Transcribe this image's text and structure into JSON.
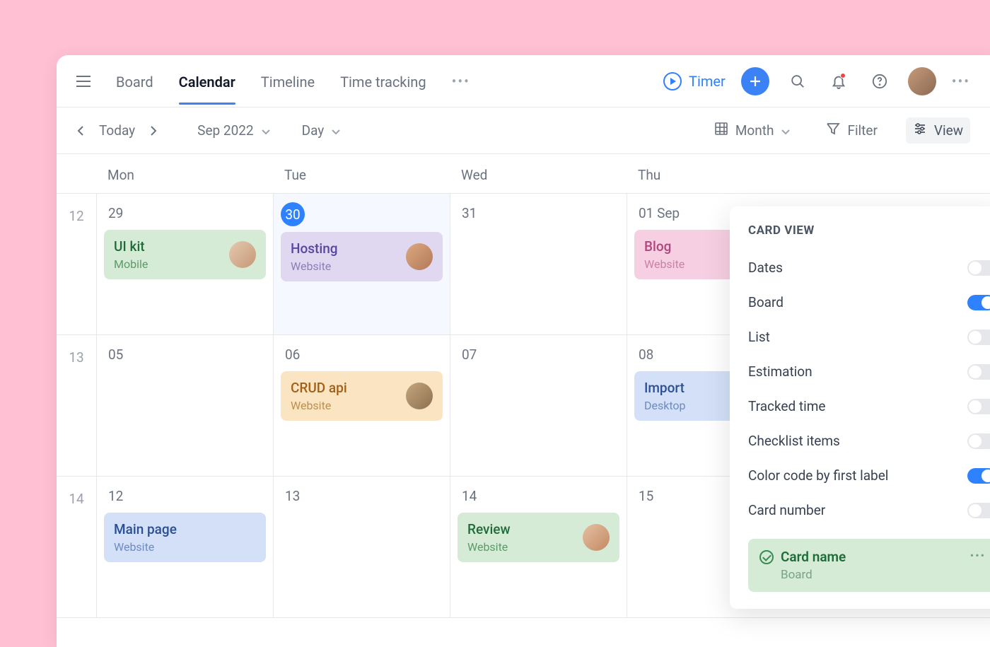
{
  "nav": {
    "tabs": [
      "Board",
      "Calendar",
      "Timeline",
      "Time tracking"
    ],
    "active_index": 1,
    "timer_label": "Timer"
  },
  "toolbar": {
    "today_label": "Today",
    "month_label": "Sep 2022",
    "granularity_label": "Day",
    "timescale_label": "Month",
    "filter_label": "Filter",
    "view_label": "View"
  },
  "calendar": {
    "weekday_headers": [
      "Mon",
      "Tue",
      "Wed",
      "Thu"
    ],
    "rows": [
      {
        "week": "12",
        "days": [
          {
            "num": "29",
            "is_today": false,
            "highlight": false,
            "cards": [
              {
                "title": "UI kit",
                "sub": "Mobile",
                "color": "green",
                "avatar_colors": [
                  "#e6c9b0",
                  "#c49876"
                ]
              }
            ]
          },
          {
            "num": "30",
            "is_today": true,
            "highlight": true,
            "cards": [
              {
                "title": "Hosting",
                "sub": "Website",
                "color": "purple",
                "avatar_colors": [
                  "#dba97f",
                  "#b3795a"
                ]
              }
            ]
          },
          {
            "num": "31",
            "is_today": false,
            "highlight": false,
            "cards": []
          },
          {
            "num": "01 Sep",
            "is_today": false,
            "highlight": false,
            "cards": [
              {
                "title": "Blog",
                "sub": "Website",
                "color": "pink",
                "avatar_colors": []
              }
            ]
          }
        ]
      },
      {
        "week": "13",
        "days": [
          {
            "num": "05",
            "is_today": false,
            "highlight": false,
            "cards": []
          },
          {
            "num": "06",
            "is_today": false,
            "highlight": false,
            "cards": [
              {
                "title": "CRUD api",
                "sub": "Website",
                "color": "orange",
                "avatar_colors": [
                  "#c4a67d",
                  "#8d7050"
                ]
              }
            ]
          },
          {
            "num": "07",
            "is_today": false,
            "highlight": false,
            "cards": []
          },
          {
            "num": "08",
            "is_today": false,
            "highlight": false,
            "cards": [
              {
                "title": "Import",
                "sub": "Desktop",
                "color": "blue",
                "avatar_colors": []
              }
            ]
          }
        ]
      },
      {
        "week": "14",
        "days": [
          {
            "num": "12",
            "is_today": false,
            "highlight": false,
            "cards": [
              {
                "title": "Main page",
                "sub": "Website",
                "color": "blue",
                "avatar_colors": []
              }
            ]
          },
          {
            "num": "13",
            "is_today": false,
            "highlight": false,
            "cards": []
          },
          {
            "num": "14",
            "is_today": false,
            "highlight": false,
            "cards": [
              {
                "title": "Review",
                "sub": "Website",
                "color": "green",
                "avatar_colors": [
                  "#e6bfa3",
                  "#c28a62"
                ]
              }
            ]
          },
          {
            "num": "15",
            "is_today": false,
            "highlight": false,
            "cards": []
          }
        ]
      }
    ]
  },
  "view_panel": {
    "title": "CARD VIEW",
    "options": [
      {
        "label": "Dates",
        "on": false
      },
      {
        "label": "Board",
        "on": true
      },
      {
        "label": "List",
        "on": false
      },
      {
        "label": "Estimation",
        "on": false
      },
      {
        "label": "Tracked time",
        "on": false
      },
      {
        "label": "Checklist items",
        "on": false
      },
      {
        "label": "Color code by first label",
        "on": true
      },
      {
        "label": "Card number",
        "on": false
      }
    ],
    "preview": {
      "title": "Card name",
      "sub": "Board"
    }
  }
}
